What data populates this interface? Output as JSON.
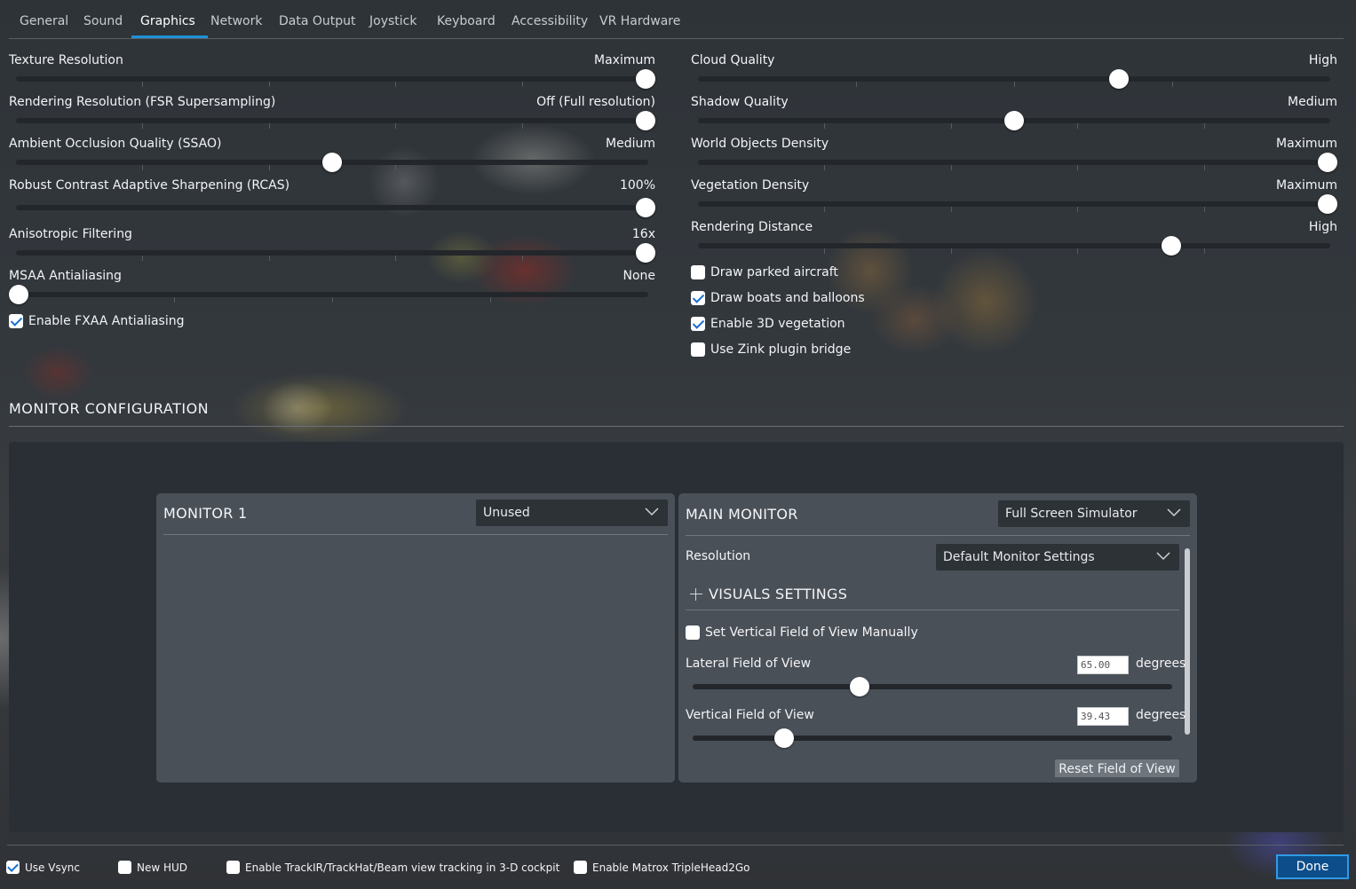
{
  "tabs": [
    "General",
    "Sound",
    "Graphics",
    "Network",
    "Data Output",
    "Joystick",
    "Keyboard",
    "Accessibility",
    "VR Hardware"
  ],
  "active_tab": "Graphics",
  "left_sliders": [
    {
      "label": "Texture Resolution",
      "value": "Maximum",
      "level": 1.0,
      "ticks": 4
    },
    {
      "label": "Rendering Resolution (FSR Supersampling)",
      "value": "Off (Full resolution)",
      "level": 1.0,
      "ticks": 4
    },
    {
      "label": "Ambient Occlusion Quality (SSAO)",
      "value": "Medium",
      "level": 0.5,
      "ticks": 4
    },
    {
      "label": "Robust Contrast Adaptive Sharpening (RCAS)",
      "value": "100%",
      "level": 1.0,
      "ticks": 0
    },
    {
      "label": "Anisotropic Filtering",
      "value": "16x",
      "level": 1.0,
      "ticks": 4
    },
    {
      "label": "MSAA Antialiasing",
      "value": "None",
      "level": 0.0,
      "ticks": 3
    }
  ],
  "right_sliders": [
    {
      "label": "Cloud Quality",
      "value": "High",
      "level": 0.667,
      "ticks": 3
    },
    {
      "label": "Shadow Quality",
      "value": "Medium",
      "level": 0.5,
      "ticks": 4
    },
    {
      "label": "World Objects Density",
      "value": "Maximum",
      "level": 1.0,
      "ticks": 4
    },
    {
      "label": "Vegetation Density",
      "value": "Maximum",
      "level": 1.0,
      "ticks": 4
    },
    {
      "label": "Rendering Distance",
      "value": "High",
      "level": 0.75,
      "ticks": 4
    }
  ],
  "left_checkboxes": [
    {
      "label": "Enable FXAA Antialiasing",
      "checked": true
    }
  ],
  "right_checkboxes": [
    {
      "label": "Draw parked aircraft",
      "checked": false
    },
    {
      "label": "Draw boats and balloons",
      "checked": true
    },
    {
      "label": "Enable 3D vegetation",
      "checked": true
    },
    {
      "label": "Use Zink plugin bridge",
      "checked": false
    }
  ],
  "monitor_section": {
    "title": "MONITOR CONFIGURATION"
  },
  "monitor1": {
    "title": "MONITOR 1",
    "mode": "Unused"
  },
  "main_monitor": {
    "title": "MAIN MONITOR",
    "mode": "Full Screen Simulator",
    "resolution_label": "Resolution",
    "resolution_value": "Default Monitor Settings",
    "visuals_title": "VISUALS SETTINGS",
    "set_vfov_label": "Set Vertical Field of View Manually",
    "set_vfov_checked": false,
    "lateral_label": "Lateral Field of View",
    "lateral_value": "65.00",
    "lateral_level": 0.343,
    "vertical_label": "Vertical Field of View",
    "vertical_value": "39.43",
    "vertical_level": 0.185,
    "degrees": "degrees",
    "reset_label": "Reset Field of View"
  },
  "bottom": {
    "vsync": {
      "label": "Use Vsync",
      "checked": true
    },
    "new_hud": {
      "label": "New HUD",
      "checked": false
    },
    "trackir": {
      "label": "Enable TrackIR/TrackHat/Beam view tracking in 3-D cockpit",
      "checked": false
    },
    "matrox": {
      "label": "Enable Matrox TripleHead2Go",
      "checked": false
    },
    "done_label": "Done"
  },
  "colors": {
    "accent": "#1e90d6",
    "done_bg": "#0c4d8a",
    "check": "#1b6fd0"
  }
}
